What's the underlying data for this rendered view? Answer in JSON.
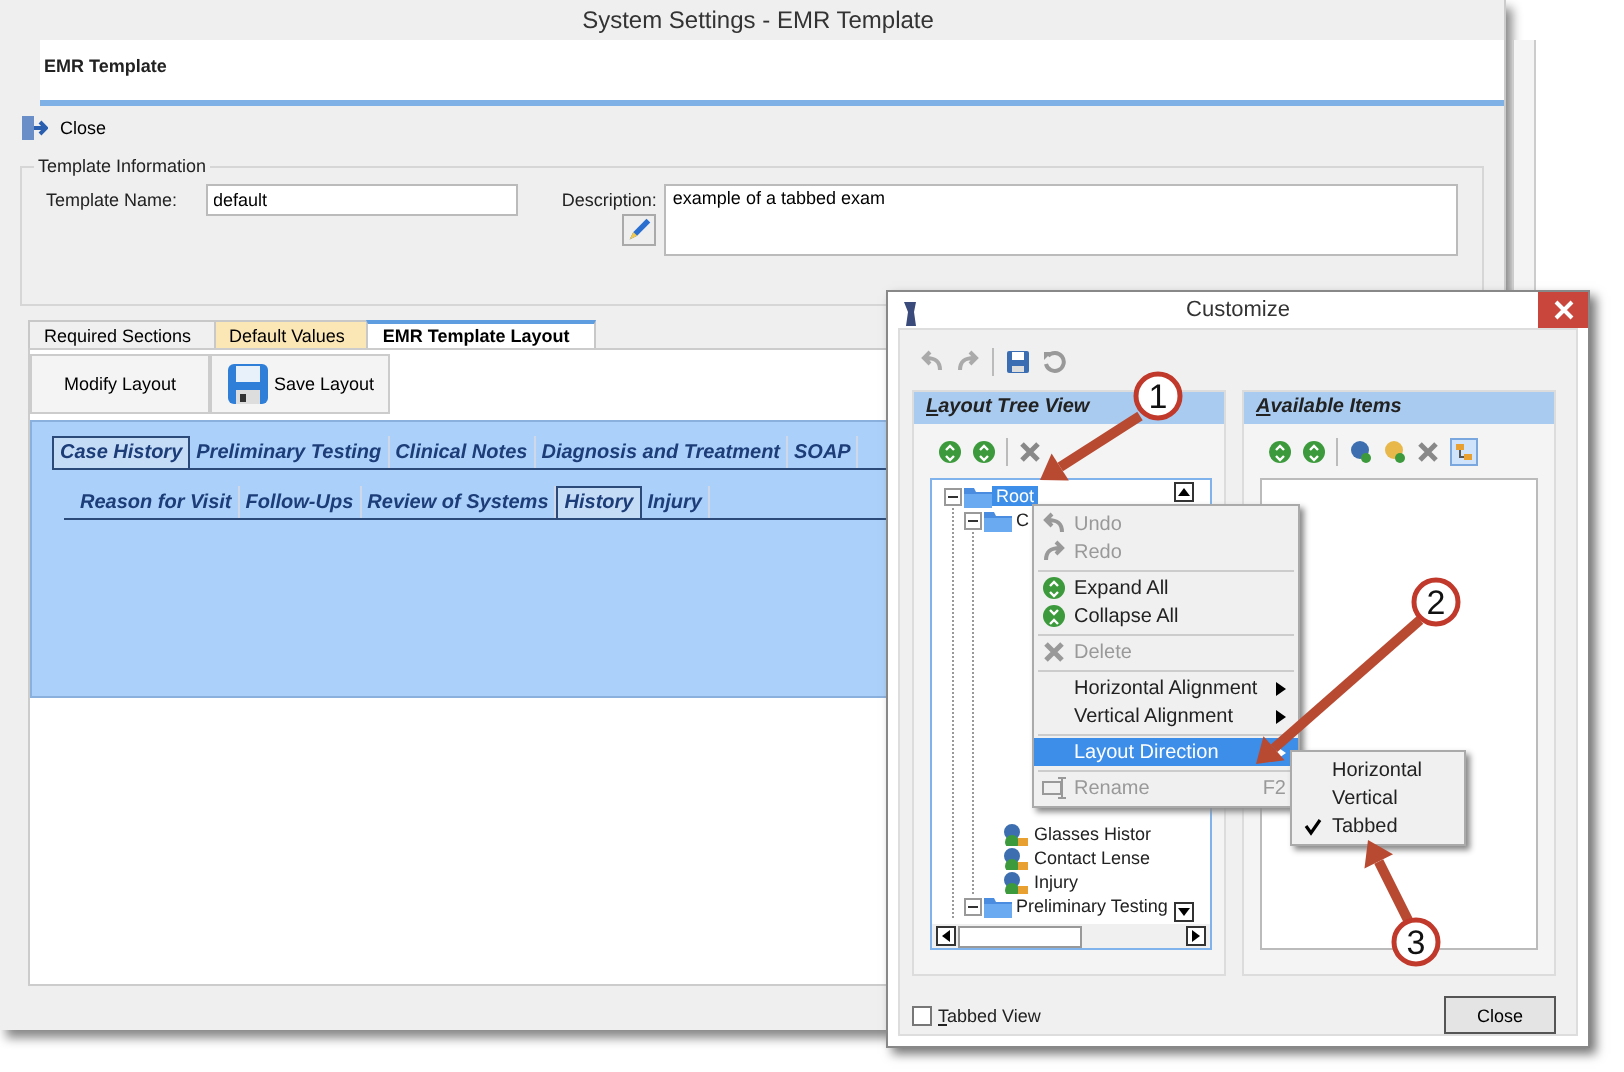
{
  "window": {
    "title": "System Settings - EMR Template"
  },
  "header": {
    "title": "EMR Template"
  },
  "toolbar": {
    "close": "Close"
  },
  "template_information": {
    "legend": "Template Information",
    "name_label": "Template Name:",
    "name_value": "default",
    "description_label": "Description:",
    "description_value": "example of a tabbed exam"
  },
  "tabs": [
    {
      "label": "Required Sections",
      "selected": false,
      "color": "#f0f0f0"
    },
    {
      "label": "Default Values",
      "selected": false,
      "color": "#fbe7b5"
    },
    {
      "label": "EMR Template Layout",
      "selected": true,
      "color": "#ffffff"
    }
  ],
  "layout_buttons": [
    {
      "label": "Modify Layout",
      "kind": "plain"
    },
    {
      "label": "Save Layout",
      "kind": "save"
    }
  ],
  "preview": {
    "tabs": [
      {
        "label": "Case History",
        "selected": true
      },
      {
        "label": "Preliminary Testing",
        "selected": false
      },
      {
        "label": "Clinical Notes",
        "selected": false
      },
      {
        "label": "Diagnosis and Treatment",
        "selected": false
      },
      {
        "label": "SOAP",
        "selected": false
      }
    ],
    "subtabs": [
      {
        "label": "Reason for Visit",
        "selected": false
      },
      {
        "label": "Follow-Ups",
        "selected": false
      },
      {
        "label": "Review of Systems",
        "selected": false
      },
      {
        "label": "History",
        "selected": true
      },
      {
        "label": "Injury",
        "selected": false
      }
    ]
  },
  "dialog": {
    "title": "Customize",
    "panels": [
      {
        "title": "Layout Tree View",
        "kind": "tree"
      },
      {
        "title": "Available Items",
        "kind": "available"
      }
    ],
    "tree": [
      {
        "label": "Root",
        "kind": "folder",
        "expanded": true,
        "selected": true,
        "children": [
          {
            "label": "C",
            "kind": "folder",
            "expanded": true,
            "selected": false,
            "children": [
              {
                "label": "Glasses Histor",
                "kind": "item",
                "selected": false
              },
              {
                "label": "Contact Lense",
                "kind": "item",
                "selected": false
              },
              {
                "label": "Injury",
                "kind": "item",
                "selected": false
              }
            ]
          },
          {
            "label": "Preliminary Testing",
            "kind": "folder",
            "expanded": true,
            "selected": false
          }
        ]
      }
    ],
    "checkbox": {
      "label": "Tabbed View",
      "checked": false
    },
    "close_button": "Close"
  },
  "context_menu": [
    {
      "kind": "undo",
      "label": "Undo",
      "disabled": true,
      "selected": false
    },
    {
      "kind": "redo",
      "label": "Redo",
      "disabled": true,
      "selected": false
    },
    {
      "kind": "separator"
    },
    {
      "kind": "expand",
      "label": "Expand All",
      "disabled": false,
      "selected": false
    },
    {
      "kind": "collapse",
      "label": "Collapse All",
      "disabled": false,
      "selected": false
    },
    {
      "kind": "separator"
    },
    {
      "kind": "delete",
      "label": "Delete",
      "disabled": true,
      "selected": false
    },
    {
      "kind": "separator"
    },
    {
      "kind": "submenu",
      "label": "Horizontal Alignment",
      "disabled": false,
      "selected": false
    },
    {
      "kind": "submenu",
      "label": "Vertical Alignment",
      "disabled": false,
      "selected": false
    },
    {
      "kind": "separator"
    },
    {
      "kind": "submenu",
      "label": "Layout Direction",
      "disabled": false,
      "selected": true
    },
    {
      "kind": "separator"
    },
    {
      "kind": "rename",
      "label": "Rename",
      "shortcut": "F2",
      "disabled": true,
      "selected": false
    }
  ],
  "submenu": [
    {
      "label": "Horizontal",
      "checked": false
    },
    {
      "label": "Vertical",
      "checked": false
    },
    {
      "label": "Tabbed",
      "checked": true
    }
  ],
  "callouts": [
    {
      "number": "1"
    },
    {
      "number": "2"
    },
    {
      "number": "3"
    }
  ]
}
